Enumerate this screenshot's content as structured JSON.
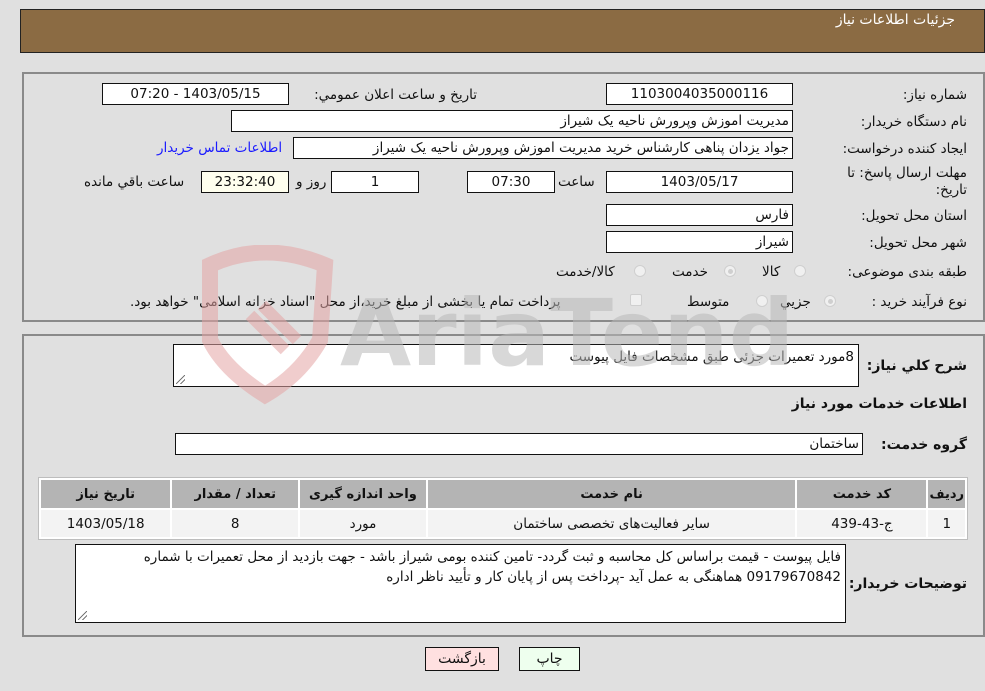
{
  "header": {
    "title": "جزئیات اطلاعات نیاز"
  },
  "fields": {
    "need_number": {
      "label": "شماره نیاز:",
      "value": "1103004035000116"
    },
    "announce_datetime": {
      "label": "تاريخ و ساعت اعلان عمومي:",
      "value": "1403/05/15 - 07:20"
    },
    "buyer_org": {
      "label": "نام دستگاه خريدار:",
      "value": "مدیریت اموزش وپرورش ناحیه یک شیراز"
    },
    "requester": {
      "label": "ايجاد کننده درخواست:",
      "value": "جواد یزدان پناهی کارشناس خرید مدیریت اموزش وپرورش ناحیه یک شیراز"
    },
    "buyer_contact_link": "اطلاعات تماس خريدار",
    "deadline": {
      "label_line1": "مهلت ارسال پاسخ: تا",
      "label_line2": "تاريخ:",
      "date": "1403/05/17",
      "time_label": "ساعت",
      "time": "07:30",
      "days": "1",
      "days_label": "روز و",
      "remaining": "23:32:40",
      "remaining_label": "ساعت باقي مانده"
    },
    "province": {
      "label": "استان محل تحويل:",
      "value": "فارس"
    },
    "city": {
      "label": "شهر محل تحويل:",
      "value": "شیراز"
    },
    "category": {
      "label": "طبقه بندی موضوعی:",
      "options": [
        "کالا",
        "خدمت",
        "کالا/خدمت"
      ],
      "selected": "خدمت"
    },
    "purchase_type": {
      "label": "نوع فرآيند خريد :",
      "options": [
        "جزيي",
        "متوسط"
      ],
      "selected": "جزيي",
      "treasury_checkbox_label": "پرداخت تمام يا بخشی از مبلغ خريد،از محل \"اسناد خزانه اسلامی\" خواهد بود."
    }
  },
  "description": {
    "label": "شرح کلي نياز:",
    "value": "8مورد تعمیرات جزئی طبق مشخصات فایل پیوست"
  },
  "services_section": {
    "title": "اطلاعات خدمات مورد نياز",
    "group_label": "گروه خدمت:",
    "group_value": "ساختمان",
    "table": {
      "headers": [
        "رديف",
        "کد خدمت",
        "نام خدمت",
        "واحد اندازه گيری",
        "تعداد / مقدار",
        "تاريخ نياز"
      ],
      "rows": [
        [
          "1",
          "ج-43-439",
          "سایر فعالیت‌های تخصصی ساختمان",
          "مورد",
          "8",
          "1403/05/18"
        ]
      ]
    }
  },
  "buyer_notes": {
    "label": "توضيحات خريدار:",
    "value": "فایل پیوست - قیمت براساس کل محاسبه و ثبت گردد- تامین کننده بومی شیراز باشد - جهت بازدید از محل تعمیرات با شماره 09179670842 هماهنگی به عمل آید -پرداخت پس از پایان کار و تأیید ناظر اداره"
  },
  "buttons": {
    "print": "چاپ",
    "back": "بازگشت"
  },
  "watermark": {
    "text": "AriaTender.neT"
  },
  "colors": {
    "header_bg": "#8b6b43",
    "print_bg": "#eeffee",
    "back_bg": "#ffe0e0",
    "link": "#1a1aff"
  }
}
